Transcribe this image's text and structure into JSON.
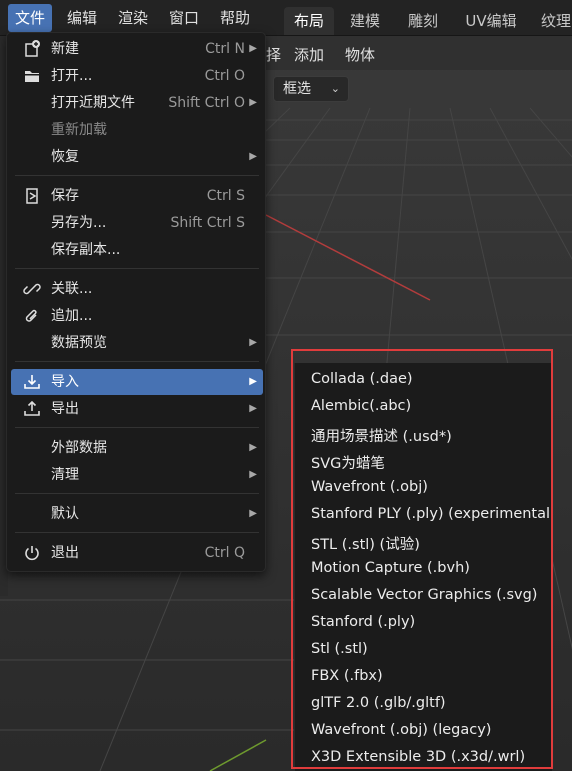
{
  "top_menu": [
    {
      "label": "文件",
      "active": true
    },
    {
      "label": "编辑"
    },
    {
      "label": "渲染"
    },
    {
      "label": "窗口"
    },
    {
      "label": "帮助"
    }
  ],
  "workspace_tabs": [
    {
      "label": "布局",
      "active": true
    },
    {
      "label": "建模"
    },
    {
      "label": "雕刻"
    },
    {
      "label": "UV编辑"
    },
    {
      "label": "纹理"
    }
  ],
  "header2": {
    "partial_label": "择",
    "add_label": "添加",
    "object_label": "物体"
  },
  "select_mode": {
    "value": "框选"
  },
  "file_menu": {
    "items": [
      {
        "id": "new",
        "label": "新建",
        "shortcut": "Ctrl N",
        "arrow": true,
        "icon": "new-file-icon"
      },
      {
        "id": "open",
        "label": "打开...",
        "shortcut": "Ctrl O",
        "icon": "folder-icon"
      },
      {
        "id": "open-recent",
        "label": "打开近期文件",
        "shortcut": "Shift Ctrl O",
        "arrow": true
      },
      {
        "id": "reload",
        "label": "重新加载",
        "disabled": true
      },
      {
        "id": "recover",
        "label": "恢复",
        "arrow": true
      },
      {
        "id": "save",
        "label": "保存",
        "shortcut": "Ctrl S",
        "icon": "save-icon"
      },
      {
        "id": "save-as",
        "label": "另存为...",
        "shortcut": "Shift Ctrl S"
      },
      {
        "id": "save-copy",
        "label": "保存副本..."
      },
      {
        "id": "link",
        "label": "关联...",
        "icon": "link-icon"
      },
      {
        "id": "append",
        "label": "追加...",
        "icon": "paperclip-icon"
      },
      {
        "id": "data-preview",
        "label": "数据预览",
        "arrow": true
      },
      {
        "id": "import",
        "label": "导入",
        "arrow": true,
        "highlight": true,
        "icon": "import-icon"
      },
      {
        "id": "export",
        "label": "导出",
        "arrow": true,
        "icon": "export-icon"
      },
      {
        "id": "external-data",
        "label": "外部数据",
        "arrow": true
      },
      {
        "id": "clean-up",
        "label": "清理",
        "arrow": true
      },
      {
        "id": "defaults",
        "label": "默认",
        "arrow": true
      },
      {
        "id": "quit",
        "label": "退出",
        "shortcut": "Ctrl Q",
        "icon": "power-icon"
      }
    ]
  },
  "import_menu": {
    "items": [
      "Collada (.dae)",
      "Alembic(.abc)",
      "通用场景描述 (.usd*)",
      "SVG为蜡笔",
      "Wavefront (.obj)",
      "Stanford PLY (.ply) (experimental)",
      "STL (.stl) (试验)",
      "Motion Capture (.bvh)",
      "Scalable Vector Graphics (.svg)",
      "Stanford (.ply)",
      "Stl (.stl)",
      "FBX (.fbx)",
      "glTF 2.0 (.glb/.gltf)",
      "Wavefront (.obj) (legacy)",
      "X3D Extensible 3D (.x3d/.wrl)"
    ]
  },
  "colors": {
    "highlight": "#4772b3",
    "annotation_box": "#e03c3c",
    "grid_axis_x": "#b23c3c",
    "grid_axis_y": "#6e9a2e"
  }
}
